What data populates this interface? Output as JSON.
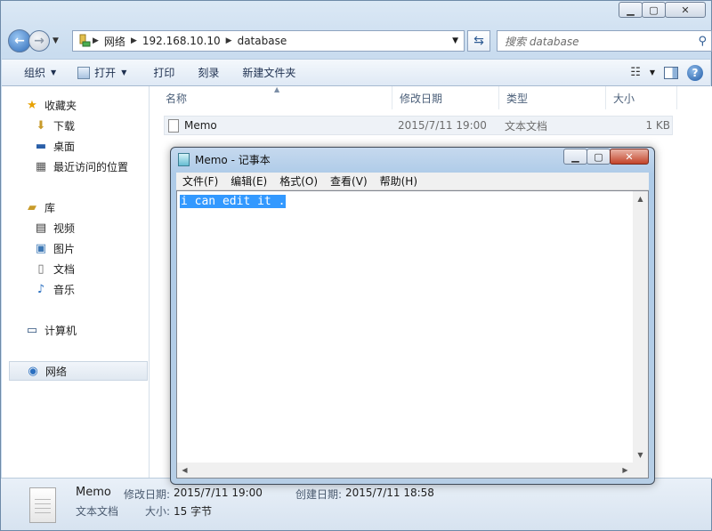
{
  "explorer": {
    "address": {
      "segments": [
        "网络",
        "192.168.10.10",
        "database"
      ]
    },
    "search": {
      "placeholder": "搜索 database"
    },
    "toolbar": {
      "organize": "组织",
      "open": "打开",
      "print": "打印",
      "burn": "刻录",
      "new_folder": "新建文件夹"
    },
    "sidebar": {
      "favorites": "收藏夹",
      "downloads": "下载",
      "desktop": "桌面",
      "recent": "最近访问的位置",
      "libraries": "库",
      "videos": "视频",
      "pictures": "图片",
      "documents": "文档",
      "music": "音乐",
      "computer": "计算机",
      "network": "网络"
    },
    "columns": {
      "name": "名称",
      "modified": "修改日期",
      "type": "类型",
      "size": "大小"
    },
    "files": [
      {
        "name": "Memo",
        "modified": "2015/7/11 19:00",
        "type": "文本文档",
        "size": "1 KB"
      }
    ],
    "details": {
      "name": "Memo",
      "type": "文本文档",
      "modified_label": "修改日期:",
      "modified_value": "2015/7/11 19:00",
      "created_label": "创建日期:",
      "created_value": "2015/7/11 18:58",
      "size_label": "大小:",
      "size_value": "15 字节"
    }
  },
  "notepad": {
    "title": "Memo - 记事本",
    "menu": [
      "文件(F)",
      "编辑(E)",
      "格式(O)",
      "查看(V)",
      "帮助(H)"
    ],
    "content": "i can edit it ."
  }
}
